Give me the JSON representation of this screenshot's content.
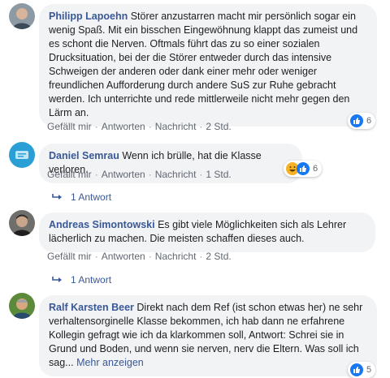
{
  "comments": [
    {
      "author": "Philipp Lapoehn",
      "text": "Störer anzustarren macht mir persönlich sogar ein wenig Spaß. Mit ein bisschen Eingewöhnung klappt das zumeist und es schont die Nerven. Oftmals führt das zu so einer sozialen Drucksituation, bei der die Störer entweder durch das intensive Schweigen der anderen oder dank einer mehr oder weniger freundlichen Aufforderung durch andere SuS zur Ruhe gebracht werden. Ich unterrichte und rede mittlerweile nicht mehr gegen den Lärm an.",
      "actions": [
        "Gefällt mir",
        "Antworten",
        "Nachricht",
        "2 Std."
      ],
      "reaction_count": "6",
      "reaction_icons": [
        "like-icon"
      ]
    },
    {
      "author": "Daniel Semrau",
      "text": "Wenn ich brülle, hat die Klasse verloren.",
      "actions": [
        "Gefällt mir",
        "Antworten",
        "Nachricht",
        "1 Std."
      ],
      "reaction_count": "6",
      "reaction_icons": [
        "haha-icon",
        "like-icon"
      ],
      "replies": "1 Antwort"
    },
    {
      "author": "Andreas Simontowski",
      "text": "Es gibt viele Möglichkeiten sich als Lehrer lächerlich zu machen. Die meisten schaffen dieses auch.",
      "actions": [
        "Gefällt mir",
        "Antworten",
        "Nachricht",
        "2 Std."
      ],
      "replies": "1 Antwort"
    },
    {
      "author": "Ralf Karsten Beer",
      "text": "Direkt nach dem Ref (ist schon etwas her) ne sehr verhaltensorginelle Klasse bekommen, ich hab dann ne erfahrene Kollegin gefragt wie ich da klarkommen soll, Antwort: Schrei sie in Grund und Boden, und wenn sie nerven, nerv die Eltern. Was soll ich sag...",
      "more": "Mehr anzeigen",
      "reaction_count": "5",
      "reaction_icons": [
        "like-icon"
      ]
    }
  ],
  "colors": {
    "author": "#385898",
    "bubble": "#f2f3f5",
    "meta": "#606770",
    "like": "#1877f2",
    "haha": "#f7b125"
  }
}
